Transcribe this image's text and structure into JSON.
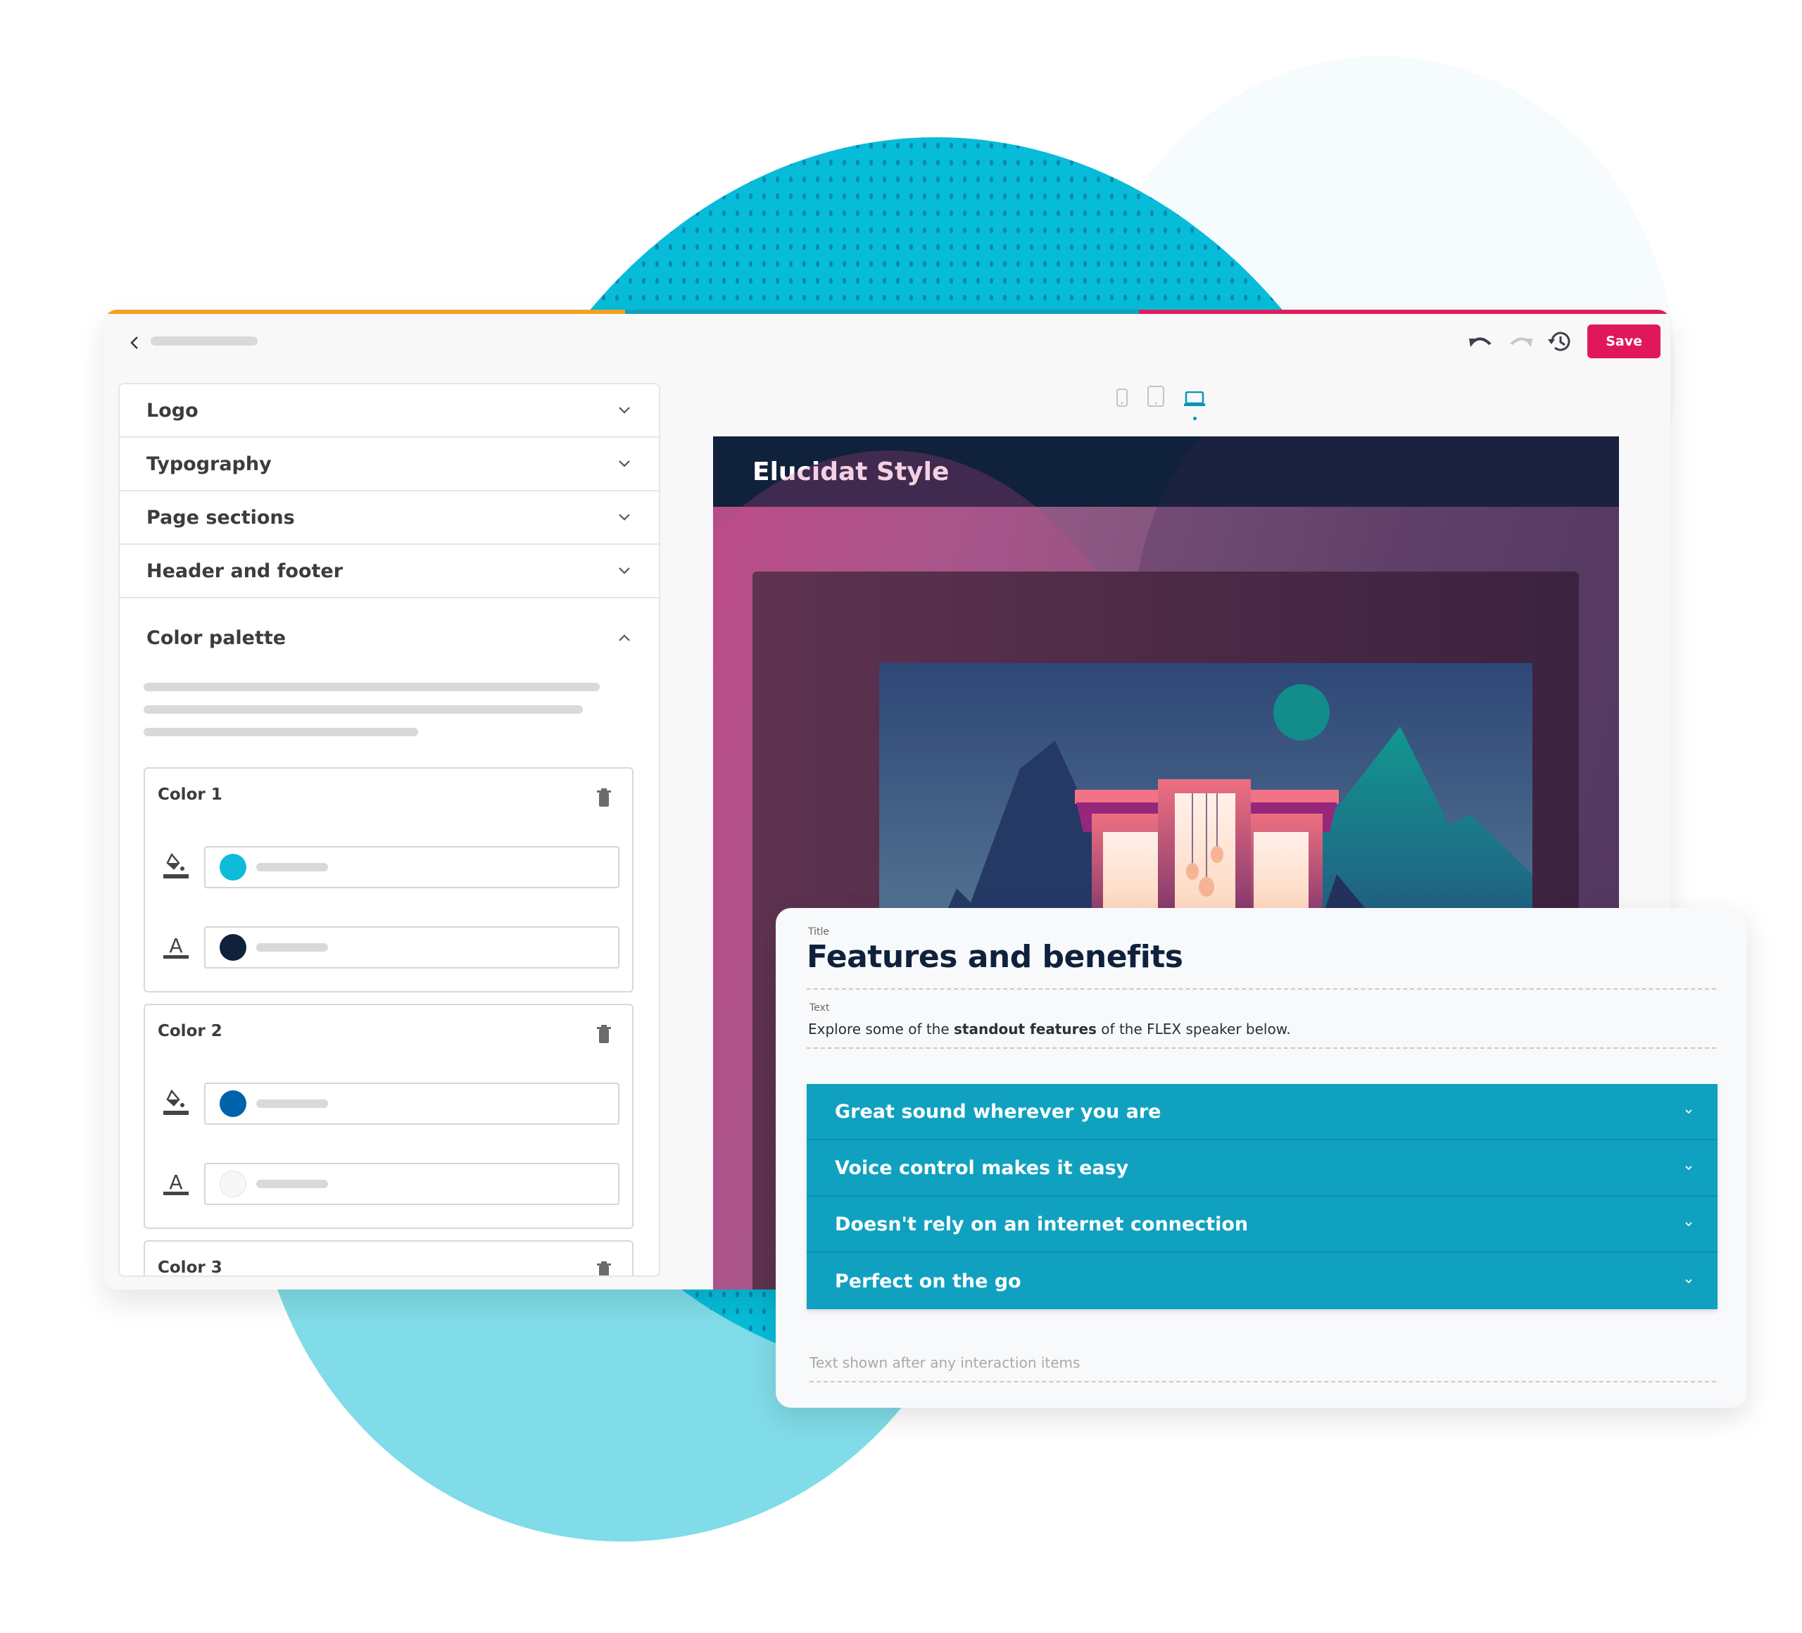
{
  "header": {
    "back_label": "Back",
    "toolbar": {
      "undo_icon": "undo-icon",
      "redo_icon": "redo-icon",
      "history_icon": "history-icon",
      "save_label": "Save"
    },
    "colors": {
      "accent_orange": "#f2a21f",
      "accent_teal": "#0ea2c0",
      "accent_pink": "#df1d5d"
    }
  },
  "sidebar": {
    "sections": [
      {
        "label": "Logo",
        "expanded": false
      },
      {
        "label": "Typography",
        "expanded": false
      },
      {
        "label": "Page sections",
        "expanded": false
      },
      {
        "label": "Header and footer",
        "expanded": false
      },
      {
        "label": "Color palette",
        "expanded": true
      }
    ],
    "color_palette": {
      "colors": [
        {
          "label": "Color 1",
          "background": "#0cbcd9",
          "text": "#0f213b"
        },
        {
          "label": "Color 2",
          "background": "#0062a8",
          "text": "#f7f7f9"
        },
        {
          "label": "Color 3"
        }
      ]
    }
  },
  "device_switcher": {
    "options": [
      {
        "name": "mobile",
        "active": false
      },
      {
        "name": "tablet",
        "active": false
      },
      {
        "name": "desktop",
        "active": true
      }
    ]
  },
  "preview": {
    "title": "Elucidat Style"
  },
  "content": {
    "title_label": "Title",
    "title": "Features and benefits",
    "text_label": "Text",
    "text_before": "Explore some of the ",
    "text_bold": "standout features",
    "text_after": " of the FLEX speaker below.",
    "accordion_items": [
      "Great sound wherever you are",
      "Voice control makes it easy",
      "Doesn't rely on an internet connection",
      "Perfect on the go"
    ],
    "after_placeholder": "Text shown after any interaction items",
    "accordion_color": "#0fa1bf"
  }
}
